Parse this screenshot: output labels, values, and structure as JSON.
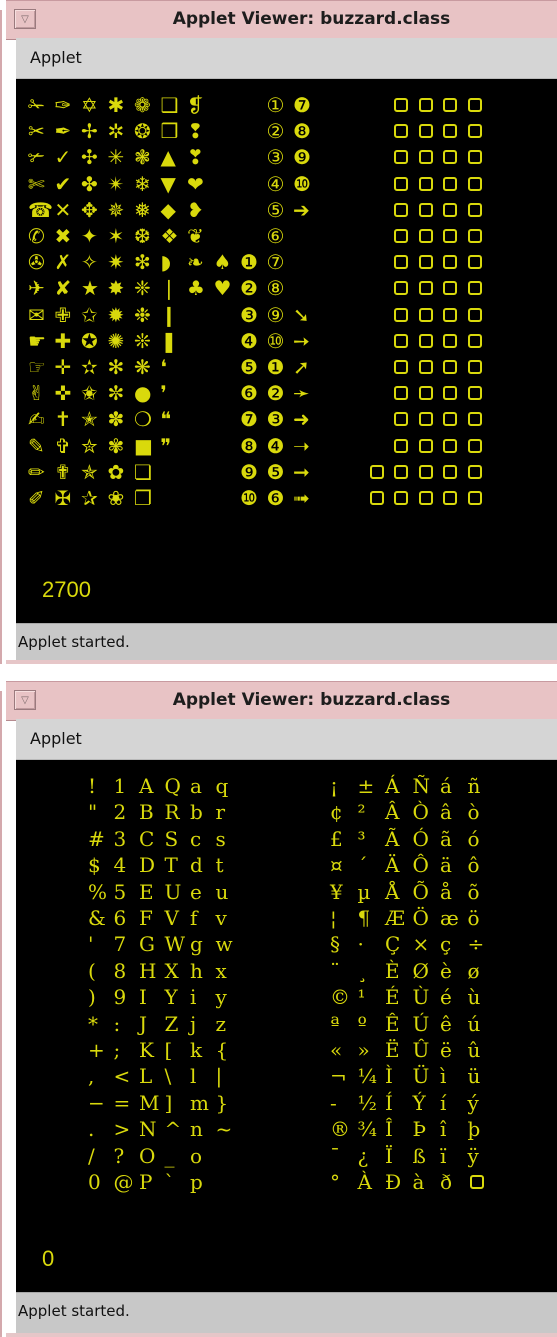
{
  "window1": {
    "title": "Applet Viewer: buzzard.class",
    "menu": "Applet",
    "status": "Applet started.",
    "counter": "2700",
    "dingbat_columns": [
      [
        "✁",
        "✂",
        "✃",
        "✄",
        "☎",
        "✆",
        "✇",
        "✈",
        "✉",
        "☛",
        "☞",
        "✌",
        "✍",
        "✎",
        "✏",
        "✐"
      ],
      [
        "✑",
        "✒",
        "✓",
        "✔",
        "✕",
        "✖",
        "✗",
        "✘",
        "✙",
        "✚",
        "✛",
        "✜",
        "✝",
        "✞",
        "✟",
        "✠"
      ],
      [
        "✡",
        "✢",
        "✣",
        "✤",
        "✥",
        "✦",
        "✧",
        "★",
        "✩",
        "✪",
        "✫",
        "✬",
        "✭",
        "✮",
        "✯",
        "✰"
      ],
      [
        "✱",
        "✲",
        "✳",
        "✴",
        "✵",
        "✶",
        "✷",
        "✸",
        "✹",
        "✺",
        "✻",
        "✼",
        "✽",
        "✾",
        "✿",
        "❀"
      ],
      [
        "❁",
        "❂",
        "❃",
        "❄",
        "❅",
        "❆",
        "❇",
        "❈",
        "❉",
        "❊",
        "❋",
        "●",
        "❍",
        "■",
        "❏",
        "❐"
      ],
      [
        "❑",
        "❒",
        "▲",
        "▼",
        "◆",
        "❖",
        "◗",
        "❘",
        "❙",
        "❚",
        "❛",
        "❜",
        "❝",
        "❞",
        "",
        ""
      ],
      [
        "❡",
        "❢",
        "❣",
        "❤",
        "❥",
        "❦",
        "❧",
        "♣",
        "",
        "",
        "",
        "",
        "",
        "",
        "",
        ""
      ],
      [
        "",
        "",
        "",
        "",
        "",
        "",
        "♠",
        "♥",
        "",
        "",
        "",
        "",
        "",
        "",
        "",
        ""
      ],
      [
        "",
        "",
        "",
        "",
        "",
        "",
        "❶",
        "❷",
        "❸",
        "❹",
        "❺",
        "❻",
        "❼",
        "❽",
        "❾",
        "❿"
      ],
      [
        "①",
        "②",
        "③",
        "④",
        "⑤",
        "⑥",
        "⑦",
        "⑧",
        "⑨",
        "⑩",
        "❶",
        "❷",
        "❸",
        "❹",
        "❺",
        "❻"
      ],
      [
        "❼",
        "❽",
        "❾",
        "❿",
        "➔",
        "",
        "",
        "",
        "➘",
        "➙",
        "➚",
        "➛",
        "➜",
        "➝",
        "➞",
        "➟"
      ]
    ]
  },
  "window2": {
    "title": "Applet Viewer: buzzard.class",
    "menu": "Applet",
    "status": "Applet started.",
    "counter": "0",
    "char_columns_left": [
      [
        "!",
        "\"",
        "#",
        "$",
        "%",
        "&",
        "'",
        "(",
        ")",
        "*",
        "+",
        ",",
        "−",
        ".",
        "/",
        "0"
      ],
      [
        "1",
        "2",
        "3",
        "4",
        "5",
        "6",
        "7",
        "8",
        "9",
        ":",
        ";",
        "<",
        "=",
        ">",
        "?",
        "@"
      ],
      [
        "A",
        "B",
        "C",
        "D",
        "E",
        "F",
        "G",
        "H",
        "I",
        "J",
        "K",
        "L",
        "M",
        "N",
        "O",
        "P"
      ],
      [
        "Q",
        "R",
        "S",
        "T",
        "U",
        "V",
        "W",
        "X",
        "Y",
        "Z",
        "[",
        "\\",
        "]",
        "^",
        "_",
        "`"
      ],
      [
        "a",
        "b",
        "c",
        "d",
        "e",
        "f",
        "g",
        "h",
        "i",
        "j",
        "k",
        "l",
        "m",
        "n",
        "o",
        "p"
      ],
      [
        "q",
        "r",
        "s",
        "t",
        "u",
        "v",
        "w",
        "x",
        "y",
        "z",
        "{",
        "|",
        "}",
        "~",
        "",
        ""
      ]
    ],
    "char_columns_right": [
      [
        "¡",
        "¢",
        "£",
        "¤",
        "¥",
        "¦",
        "§",
        "¨",
        "©",
        "ª",
        "«",
        "¬",
        "-",
        "®",
        "¯",
        "°"
      ],
      [
        "±",
        "²",
        "³",
        "´",
        "µ",
        "¶",
        "·",
        "¸",
        "¹",
        "º",
        "»",
        "¼",
        "½",
        "¾",
        "¿",
        "À"
      ],
      [
        "Á",
        "Â",
        "Ã",
        "Ä",
        "Å",
        "Æ",
        "Ç",
        "È",
        "É",
        "Ê",
        "Ë",
        "Ì",
        "Í",
        "Î",
        "Ï",
        "Ð"
      ],
      [
        "Ñ",
        "Ò",
        "Ó",
        "Ô",
        "Õ",
        "Ö",
        "×",
        "Ø",
        "Ù",
        "Ú",
        "Û",
        "Ü",
        "Ý",
        "Þ",
        "ß",
        "à"
      ],
      [
        "á",
        "â",
        "ã",
        "ä",
        "å",
        "æ",
        "ç",
        "è",
        "é",
        "ê",
        "ë",
        "ì",
        "í",
        "î",
        "ï",
        "ð"
      ],
      [
        "ñ",
        "ò",
        "ó",
        "ô",
        "õ",
        "ö",
        "÷",
        "ø",
        "ù",
        "ú",
        "û",
        "ü",
        "ý",
        "þ",
        "ÿ",
        ""
      ]
    ]
  },
  "colors": {
    "glyph": "#d9d90c",
    "applet_bg": "#000000",
    "titlebar": "#e8c3c5",
    "menubar": "#d5d5d5"
  }
}
